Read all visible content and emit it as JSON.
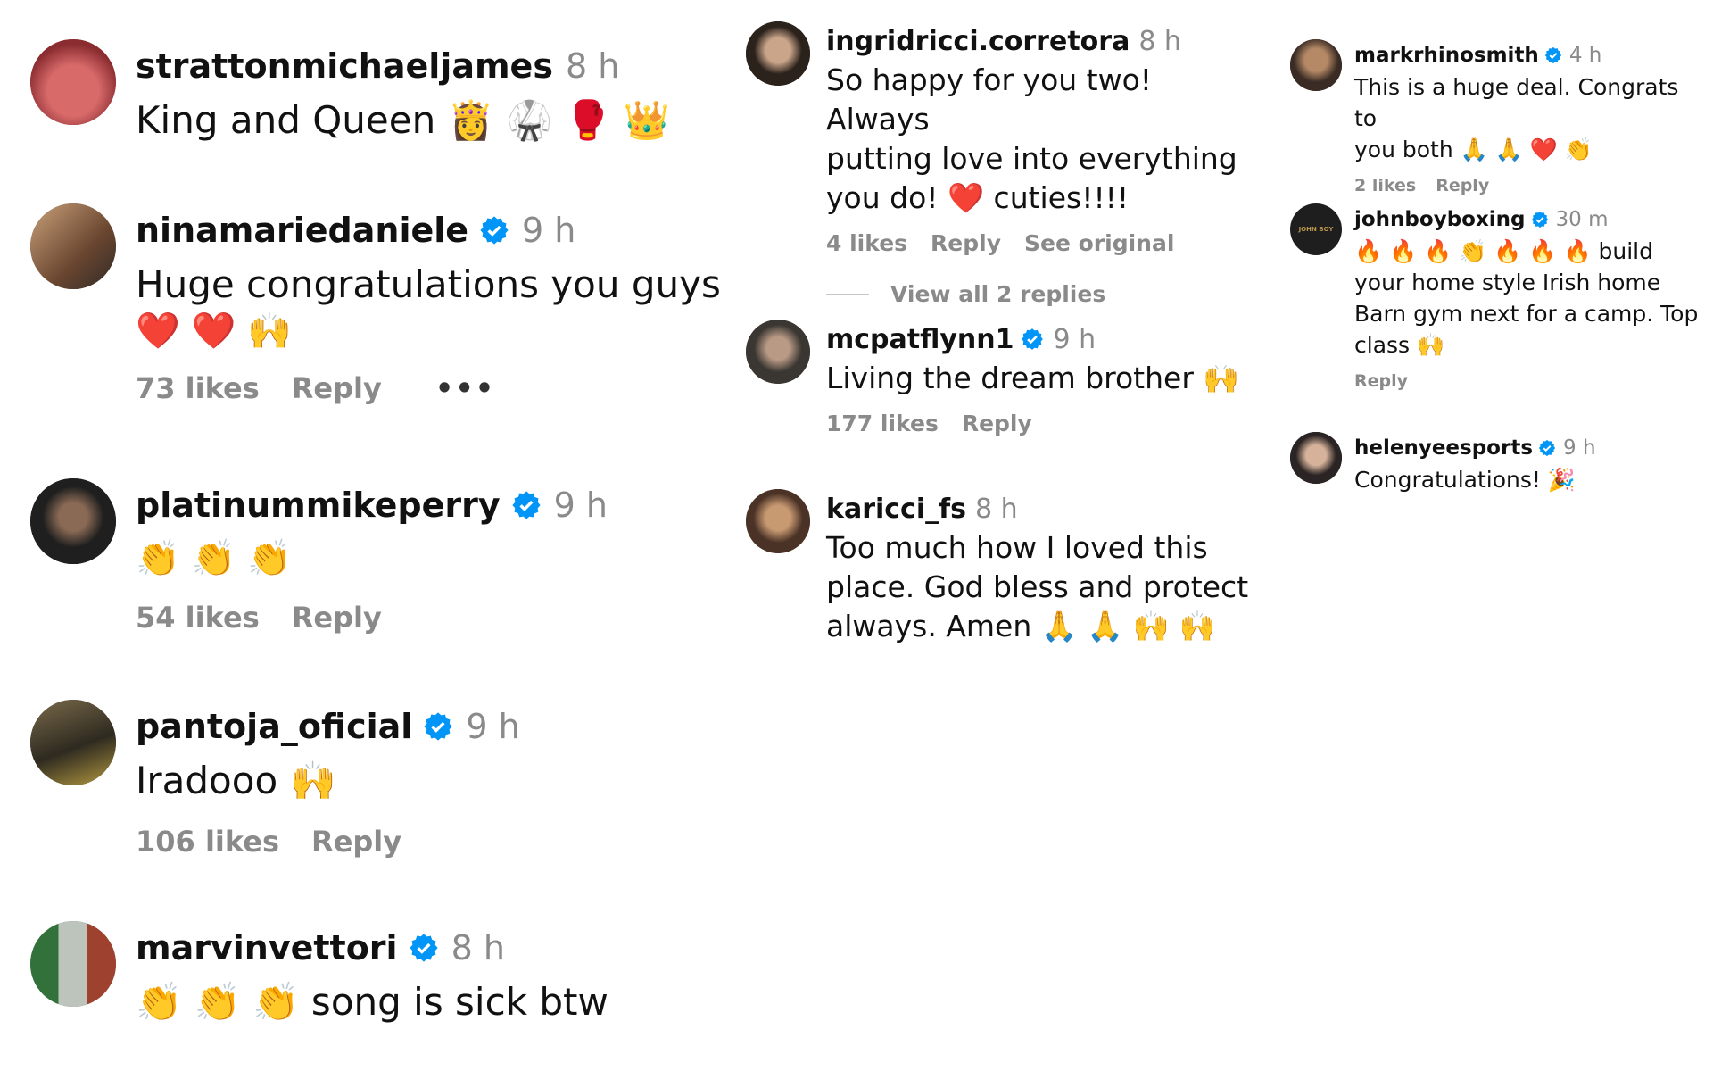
{
  "accent": "#0095f6",
  "column1": {
    "comments": [
      {
        "username": "strattonmichaeljames",
        "verified": false,
        "time": "8 h",
        "text": "King and Queen 👸 🥋 🥊 👑",
        "likes": "",
        "reply": "",
        "avatar_color": "#b5494f"
      },
      {
        "username": "ninamariedaniele",
        "verified": true,
        "time": "9 h",
        "text": "Huge congratulations you guys",
        "emoji_line": "❤️ ❤️ 🙌",
        "likes": "73 likes",
        "reply": "Reply",
        "more": "•••",
        "avatar_color": "#7a5a44"
      },
      {
        "username": "platinummikeperry",
        "verified": true,
        "time": "9 h",
        "text": "👏 👏 👏",
        "likes": "54 likes",
        "reply": "Reply",
        "avatar_color": "#2b2b2b"
      },
      {
        "username": "pantoja_oficial",
        "verified": true,
        "time": "9 h",
        "text": "Iradooo 🙌",
        "likes": "106 likes",
        "reply": "Reply",
        "avatar_color": "#3d3a2a"
      },
      {
        "username": "marvinvettori",
        "verified": true,
        "time": "8 h",
        "text": "👏 👏 👏 song is sick btw",
        "likes": "",
        "reply": "",
        "avatar_color": "#3a5a3a"
      }
    ]
  },
  "column2": {
    "comments": [
      {
        "username": "ingridricci.corretora",
        "verified": false,
        "time": "8 h",
        "text_lines": [
          "So happy for you two! Always",
          "putting love into everything",
          "you do! ❤️ cuties!!!!"
        ],
        "likes": "4 likes",
        "reply": "Reply",
        "see_original": "See original",
        "view_replies": "View all 2 replies",
        "avatar_color": "#3b3128"
      },
      {
        "username": "mcpatflynn1",
        "verified": true,
        "time": "9 h",
        "text_lines": [
          "Living the dream brother 🙌"
        ],
        "likes": "177 likes",
        "reply": "Reply",
        "avatar_color": "#5a5550"
      },
      {
        "username": "karicci_fs",
        "verified": false,
        "time": "8 h",
        "text_lines": [
          "Too much how I loved this",
          "place. God bless and protect",
          "always. Amen 🙏 🙏 🙌 🙌"
        ],
        "likes": "",
        "reply": "",
        "avatar_color": "#6b4a38"
      }
    ]
  },
  "column3": {
    "comments": [
      {
        "username": "markrhinosmith",
        "verified": true,
        "time": "4 h",
        "text_lines": [
          "This is a huge deal. Congrats to",
          "you both 🙏 🙏 ❤️ 👏"
        ],
        "likes": "2 likes",
        "reply": "Reply",
        "avatar_color": "#4a3a30"
      },
      {
        "username": "johnboyboxing",
        "verified": true,
        "time": "30 m",
        "text_lines": [
          "🔥 🔥 🔥 👏 🔥 🔥 🔥 build",
          "your home style Irish home",
          "Barn gym next for a camp. Top",
          "class 🙌"
        ],
        "likes": "",
        "reply": "Reply",
        "avatar_color": "#1e1e1e",
        "avatar_text": "JOHN BOY"
      },
      {
        "username": "helenyeesports",
        "verified": true,
        "time": "9 h",
        "text_lines": [
          "Congratulations! 🎉"
        ],
        "likes": "",
        "reply": "",
        "avatar_color": "#2e2a2a"
      }
    ]
  }
}
